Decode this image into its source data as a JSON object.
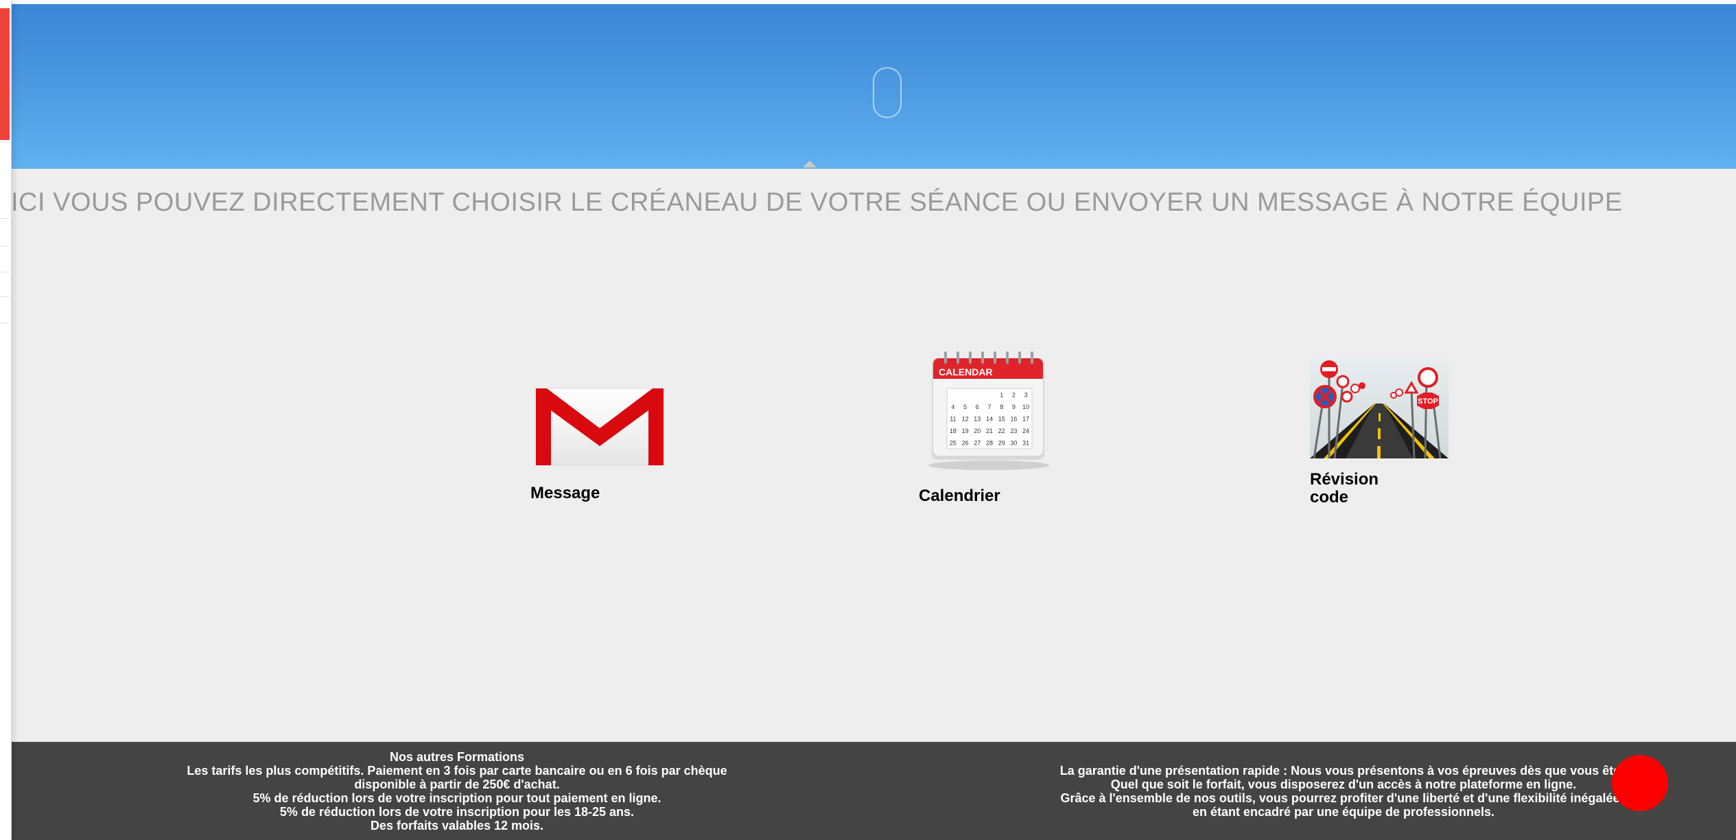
{
  "banner": {
    "tagline": "ICI VOUS POUVEZ DIRECTEMENT CHOISIR LE CRÉANEAU DE VOTRE SÉANCE OU ENVOYER UN MESSAGE À NOTRE ÉQUIPE"
  },
  "tiles": [
    {
      "label": "Message",
      "icon": "gmail-envelope-icon"
    },
    {
      "label": "Calendrier",
      "icon": "calendar-icon",
      "header": "CALENDAR"
    },
    {
      "label_line1": "Révision",
      "label_line2": "code",
      "icon": "road-signs-icon"
    }
  ],
  "calendar_days": [
    [
      "",
      "",
      "",
      "",
      "1",
      "2",
      "3"
    ],
    [
      "4",
      "5",
      "6",
      "7",
      "8",
      "9",
      "10"
    ],
    [
      "11",
      "12",
      "13",
      "14",
      "15",
      "16",
      "17"
    ],
    [
      "18",
      "19",
      "20",
      "21",
      "22",
      "23",
      "24"
    ],
    [
      "25",
      "26",
      "27",
      "28",
      "29",
      "30",
      "31"
    ]
  ],
  "footer": {
    "left": {
      "title": "Nos autres Formations",
      "line1": "Les tarifs les plus compétitifs. Paiement en 3 fois par carte bancaire ou en 6 fois par chèque",
      "line2": "disponible à partir de 250€ d'achat.",
      "line3": "5% de réduction lors de votre inscription pour tout paiement en ligne.",
      "line4": "5% de réduction lors de votre inscription pour les 18-25 ans.",
      "line5": "Des forfaits valables 12 mois."
    },
    "right": {
      "line1": "La garantie d'une présentation rapide : Nous vous présentons à vos épreuves dès que vous êtes",
      "line2": "Quel que soit le forfait, vous disposerez d'un accès à notre plateforme en ligne.",
      "line3": "Grâce à l'ensemble de nos outils, vous pourrez profiter d'une liberté et d'une flexibilité inégalées",
      "line4": "en étant encadré par une équipe de professionnels."
    }
  },
  "colors": {
    "brand_red": "#e0141b",
    "footer_bg": "#444444",
    "sky_top": "#3b86d6",
    "sky_bottom": "#62b1f0"
  }
}
